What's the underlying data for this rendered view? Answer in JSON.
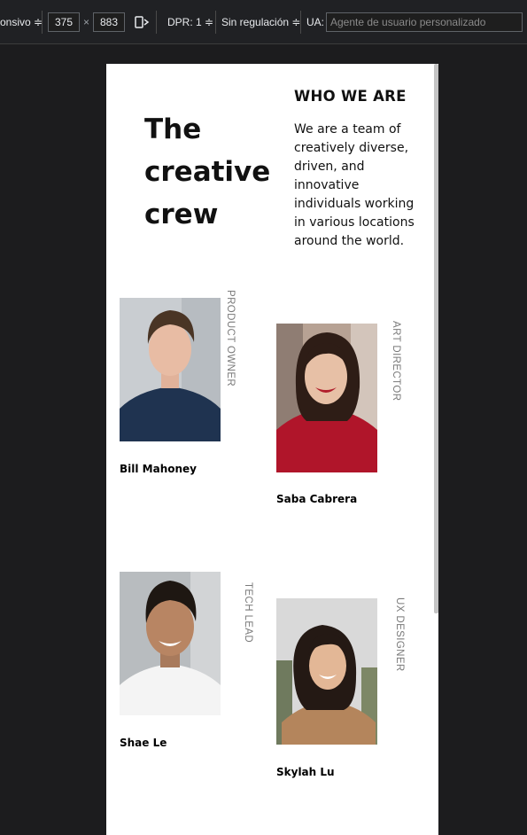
{
  "toolbar": {
    "mode": "onsivo ≑",
    "width": "375",
    "times": "×",
    "height": "883",
    "dpr": "DPR: 1 ≑",
    "throttle": "Sin regulación ≑",
    "ua_label": "UA:",
    "ua_placeholder": "Agente de usuario personalizado"
  },
  "hero": {
    "title": "The creative crew",
    "heading": "WHO WE ARE",
    "text": "We are a team of creatively diverse, driven, and innovative individuals working in various locations around the world."
  },
  "team": [
    {
      "name": "Bill Mahoney",
      "role": "PRODUCT OWNER",
      "photo": "bill-mahoney-photo"
    },
    {
      "name": "Saba Cabrera",
      "role": "ART DIRECTOR",
      "photo": "saba-cabrera-photo"
    },
    {
      "name": "Shae Le",
      "role": "TECH LEAD",
      "photo": "shae-le-photo"
    },
    {
      "name": "Skylah Lu",
      "role": "UX DESIGNER",
      "photo": "skylah-lu-photo"
    }
  ]
}
